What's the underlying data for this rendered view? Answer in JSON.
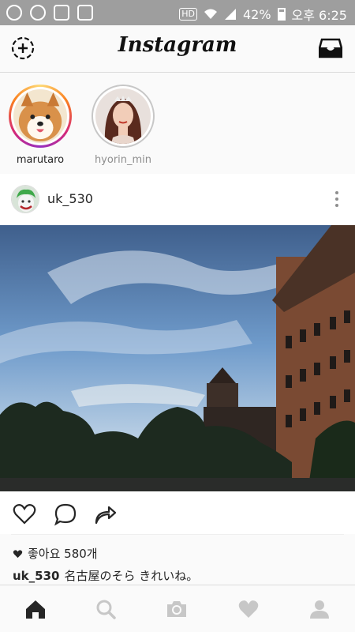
{
  "status_bar": {
    "network": "42%",
    "time": "오후 6:25",
    "hd": "HD"
  },
  "app": {
    "title": "Instagram"
  },
  "stories": [
    {
      "username": "marutaro",
      "seen": false
    },
    {
      "username": "hyorin_min",
      "seen": true
    }
  ],
  "post": {
    "username": "uk_530",
    "likes_label": "좋아요 580개",
    "caption_user": "uk_530",
    "caption_text": "名古屋のそら きれいね。"
  },
  "icons": {
    "top_left": "new-story-icon",
    "top_right": "inbox-icon",
    "actions": [
      "heart-icon",
      "comment-icon",
      "share-icon"
    ],
    "nav": [
      "home-icon",
      "search-icon",
      "camera-icon",
      "activity-heart-icon",
      "profile-icon"
    ]
  },
  "colors": {
    "accent": "#262626",
    "inactive": "#c7c7c7",
    "story_ring": "#d62976"
  }
}
